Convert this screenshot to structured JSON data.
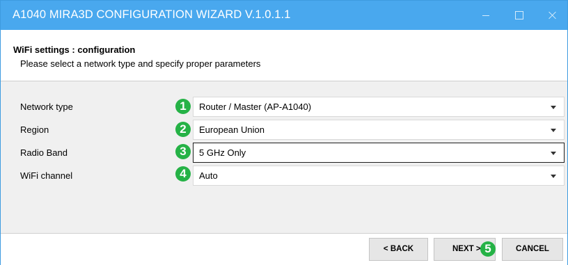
{
  "window": {
    "title": "A1040 MIRA3D CONFIGURATION WIZARD V.1.0.1.1",
    "accent_color": "#49a8ee",
    "controls": [
      "minimize-icon",
      "maximize-icon",
      "close-icon"
    ]
  },
  "header": {
    "title": "WiFi settings : configuration",
    "subtitle": "Please select a network type and specify proper parameters"
  },
  "form": {
    "rows": [
      {
        "label": "Network type",
        "value": "Router / Master (AP-A1040)",
        "badge": "1"
      },
      {
        "label": "Region",
        "value": "European Union",
        "badge": "2"
      },
      {
        "label": "Radio Band",
        "value": "5 GHz Only",
        "badge": "3",
        "focused": true
      },
      {
        "label": "WiFi channel",
        "value": "Auto",
        "badge": "4"
      }
    ],
    "badge_color": "#25b246"
  },
  "footer": {
    "back_label": "< BACK",
    "next_label": "NEXT >",
    "next_badge": "5",
    "cancel_label": "CANCEL"
  }
}
